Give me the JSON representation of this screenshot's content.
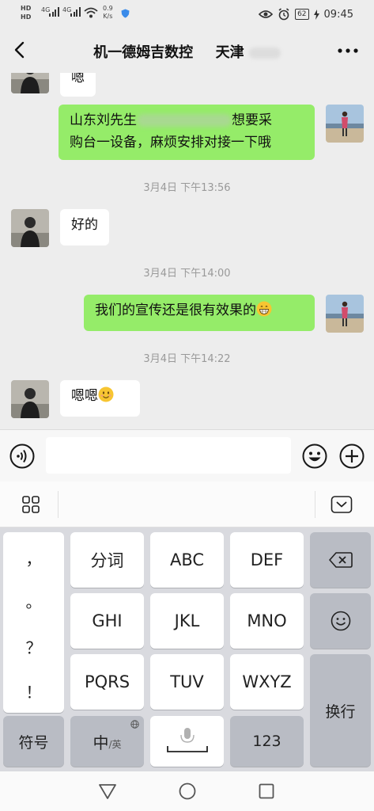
{
  "status_bar": {
    "hd_top": "HD",
    "hd_bottom": "HD",
    "net1": "4G",
    "net2": "4G",
    "speed_value": "0.9",
    "speed_unit": "K/s",
    "battery": "62",
    "time": "09:45"
  },
  "header": {
    "title": "机一德姆吉数控",
    "title_suffix": "天津"
  },
  "messages": [
    {
      "side": "left",
      "text": "嗯"
    },
    {
      "side": "right",
      "line1a": "山东刘先生",
      "line1b": "想要采",
      "line2": "购台一设备，麻烦安排对接一下哦"
    },
    {
      "type": "time",
      "text": "3月4日 下午13:56"
    },
    {
      "side": "left",
      "text": "好的"
    },
    {
      "type": "time",
      "text": "3月4日 下午14:00"
    },
    {
      "side": "right",
      "text": "我们的宣传还是很有效果的",
      "emoji": "grinning-emoji"
    },
    {
      "type": "time",
      "text": "3月4日 下午14:22"
    },
    {
      "side": "left",
      "text": "嗯嗯",
      "emoji": "smiling-emoji"
    }
  ],
  "keyboard": {
    "punct": [
      "，",
      "。",
      "？",
      "！"
    ],
    "row1": [
      "分词",
      "ABC",
      "DEF"
    ],
    "row2": [
      "GHI",
      "JKL",
      "MNO"
    ],
    "row3": [
      "PQRS",
      "TUV",
      "WXYZ"
    ],
    "enter": "换行",
    "symbols": "符号",
    "lang_main": "中",
    "lang_alt": "/英",
    "numbers": "123"
  },
  "colors": {
    "sent_bubble": "#95ec69",
    "received_bubble": "#ffffff",
    "chat_bg": "#ededed"
  }
}
